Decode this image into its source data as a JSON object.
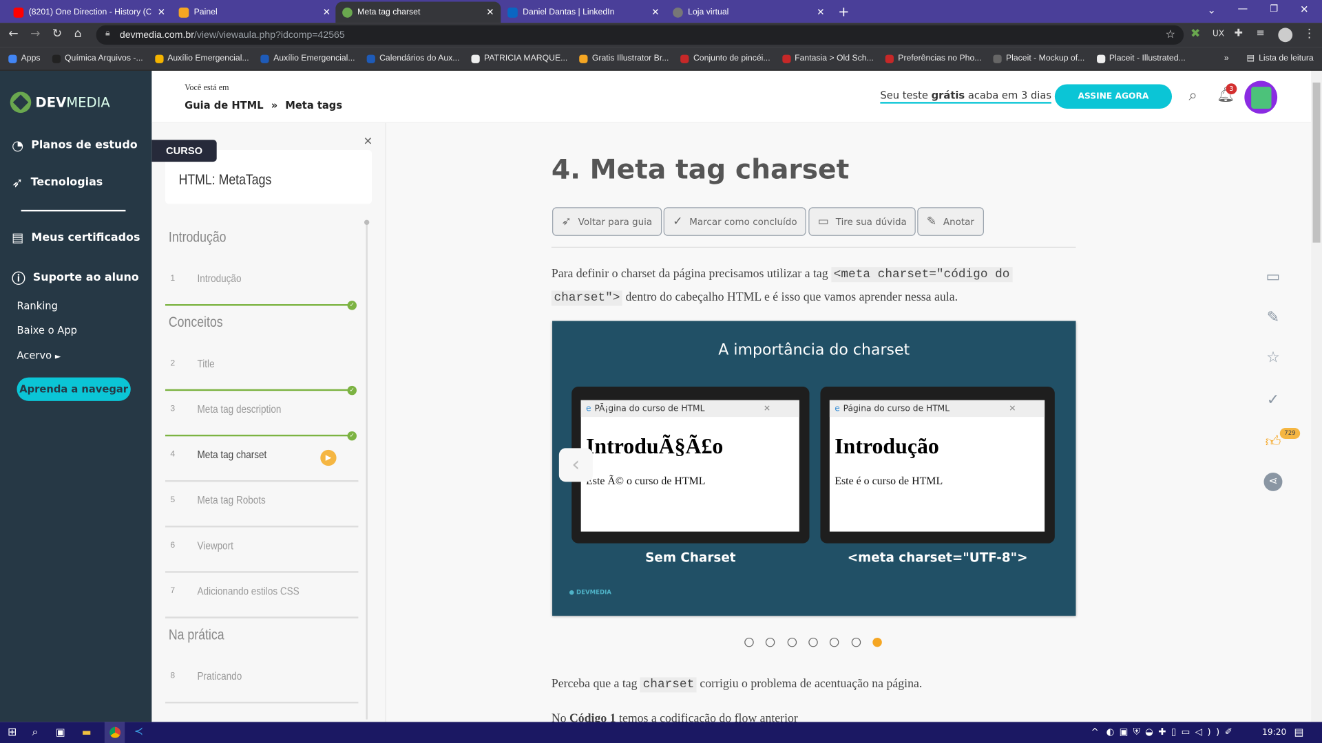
{
  "browser": {
    "tabs": [
      {
        "title": "(8201) One Direction - History (O",
        "icon": "youtube-icon",
        "color": "#ff0000"
      },
      {
        "title": "Painel",
        "icon": "painel-icon",
        "color": "#f5a623"
      },
      {
        "title": "Meta tag charset",
        "icon": "devmedia-icon",
        "color": "#6aa84f",
        "active": true
      },
      {
        "title": "Daniel Dantas | LinkedIn",
        "icon": "linkedin-icon",
        "color": "#0a66c2"
      },
      {
        "title": "Loja virtual",
        "icon": "globe-icon",
        "color": "#777"
      }
    ],
    "url_host": "devmedia.com.br",
    "url_path": "/view/viewaula.php?idcomp=42565",
    "bookmarks": [
      "Apps",
      "Química Arquivos -...",
      "Auxílio Emergencial...",
      "Auxílio Emergencial...",
      "Calendários do Aux...",
      "PATRICIA MARQUE...",
      "Gratis Illustrator Br...",
      "Conjunto de pincéi...",
      "Fantasia > Old Sch...",
      "Preferências no Pho...",
      "Placeit - Mockup of...",
      "Placeit - Illustrated..."
    ],
    "reading_list": "Lista de leitura"
  },
  "sidebar": {
    "logo_bold": "DEV",
    "logo_light": "MEDIA",
    "items": [
      {
        "label": "Planos de estudo",
        "icon": "chart-icon"
      },
      {
        "label": "Tecnologias",
        "icon": "compass-icon"
      },
      {
        "label": "Meus certificados",
        "icon": "certificate-icon"
      },
      {
        "label": "Suporte ao aluno",
        "icon": "help-icon"
      }
    ],
    "links": [
      "Ranking",
      "Baixe o App",
      "Acervo"
    ],
    "cta": "Aprenda a navegar"
  },
  "header": {
    "you_are": "Você está em",
    "crumbs": [
      "Guia de HTML",
      "»",
      "Meta tags"
    ],
    "trial_pre": "Seu teste ",
    "trial_bold": "grátis",
    "trial_post": " acaba em 3 dias",
    "subscribe": "ASSINE AGORA",
    "notif_count": "3",
    "accent": "#0bc5d6"
  },
  "course": {
    "badge": "CURSO",
    "title": "HTML: MetaTags",
    "sections": [
      {
        "title": "Introdução",
        "lessons": [
          {
            "n": "1",
            "t": "Introdução",
            "done": true
          }
        ]
      },
      {
        "title": "Conceitos",
        "lessons": [
          {
            "n": "2",
            "t": "Title",
            "done": true
          },
          {
            "n": "3",
            "t": "Meta tag description",
            "done": true
          },
          {
            "n": "4",
            "t": "Meta tag charset",
            "current": true
          },
          {
            "n": "5",
            "t": "Meta tag Robots"
          },
          {
            "n": "6",
            "t": "Viewport"
          },
          {
            "n": "7",
            "t": "Adicionando estilos CSS"
          }
        ]
      },
      {
        "title": "Na prática",
        "lessons": [
          {
            "n": "8",
            "t": "Praticando"
          }
        ]
      }
    ]
  },
  "main": {
    "title": "4. Meta tag charset",
    "actions": [
      "Voltar para guia",
      "Marcar como concluído",
      "Tire sua dúvida",
      "Anotar"
    ],
    "p1_a": "Para definir o charset da página precisamos utilizar a tag ",
    "p1_code1": "<meta charset=\"código do",
    "p1_code2": "charset\">",
    "p1_b": " dentro do cabeçalho HTML e é isso que vamos aprender nessa aula.",
    "slide": {
      "title": "A importância do charset",
      "left": {
        "tab": "PÃ¡gina do curso de HTML",
        "h1": "IntroduÃ§Ã£o",
        "p": "Este Ã© o curso de HTML",
        "caption": "Sem Charset"
      },
      "right": {
        "tab": "Página do curso de HTML",
        "h1": "Introdução",
        "p": "Este é o curso de HTML",
        "caption": "<meta charset=\"UTF-8\">"
      },
      "watermark": "DEVMEDIA",
      "total": 7,
      "current": 7
    },
    "p2_a": "Perceba que a tag ",
    "p2_code": "charset",
    "p2_b": " corrigiu o problema de acentuação na página.",
    "p3_a": "No ",
    "p3_bold": "Código 1",
    "p3_b": " temos a codificação do flow anterior"
  },
  "right_rail": {
    "icons": [
      "comment-icon",
      "note-icon",
      "star-icon",
      "check-icon",
      "like-icon",
      "share-icon"
    ],
    "likes": "729"
  },
  "taskbar": {
    "time": "19:20"
  }
}
